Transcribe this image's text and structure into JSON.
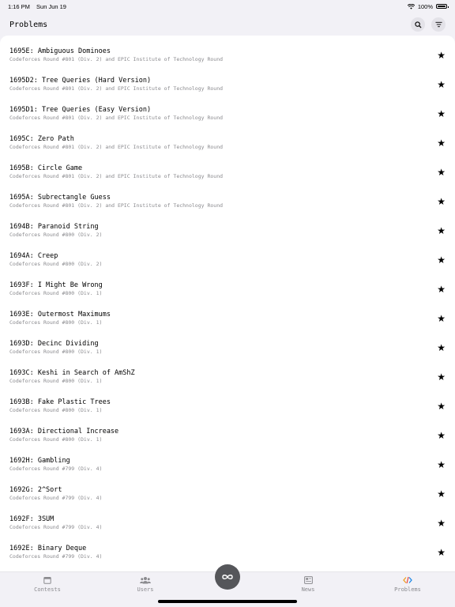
{
  "status": {
    "time": "1:16 PM",
    "date": "Sun Jun 19",
    "battery": "100%"
  },
  "nav": {
    "title": "Problems",
    "search_icon": "search-icon",
    "filter_icon": "filter-icon"
  },
  "problems": [
    {
      "title": "1695E: Ambiguous Dominoes",
      "contest": "Codeforces Round #801 (Div. 2) and EPIC Institute of Technology Round"
    },
    {
      "title": "1695D2: Tree Queries (Hard Version)",
      "contest": "Codeforces Round #801 (Div. 2) and EPIC Institute of Technology Round"
    },
    {
      "title": "1695D1: Tree Queries (Easy Version)",
      "contest": "Codeforces Round #801 (Div. 2) and EPIC Institute of Technology Round"
    },
    {
      "title": "1695C: Zero Path",
      "contest": "Codeforces Round #801 (Div. 2) and EPIC Institute of Technology Round"
    },
    {
      "title": "1695B: Circle Game",
      "contest": "Codeforces Round #801 (Div. 2) and EPIC Institute of Technology Round"
    },
    {
      "title": "1695A: Subrectangle Guess",
      "contest": "Codeforces Round #801 (Div. 2) and EPIC Institute of Technology Round"
    },
    {
      "title": "1694B: Paranoid String",
      "contest": "Codeforces Round #800 (Div. 2)"
    },
    {
      "title": "1694A: Creep",
      "contest": "Codeforces Round #800 (Div. 2)"
    },
    {
      "title": "1693F: I Might Be Wrong",
      "contest": "Codeforces Round #800 (Div. 1)"
    },
    {
      "title": "1693E: Outermost Maximums",
      "contest": "Codeforces Round #800 (Div. 1)"
    },
    {
      "title": "1693D: Decinc Dividing",
      "contest": "Codeforces Round #800 (Div. 1)"
    },
    {
      "title": "1693C: Keshi in Search of AmShZ",
      "contest": "Codeforces Round #800 (Div. 1)"
    },
    {
      "title": "1693B: Fake Plastic Trees",
      "contest": "Codeforces Round #800 (Div. 1)"
    },
    {
      "title": "1693A: Directional Increase",
      "contest": "Codeforces Round #800 (Div. 1)"
    },
    {
      "title": "1692H: Gambling",
      "contest": "Codeforces Round #799 (Div. 4)"
    },
    {
      "title": "1692G: 2^Sort",
      "contest": "Codeforces Round #799 (Div. 4)"
    },
    {
      "title": "1692F: 3SUM",
      "contest": "Codeforces Round #799 (Div. 4)"
    },
    {
      "title": "1692E: Binary Deque",
      "contest": "Codeforces Round #799 (Div. 4)"
    }
  ],
  "star_icon": "star-icon",
  "tabs": [
    {
      "label": "Contests",
      "icon": "calendar-icon"
    },
    {
      "label": "Users",
      "icon": "users-icon"
    },
    {
      "label": "News",
      "icon": "news-icon"
    },
    {
      "label": "Problems",
      "icon": "code-icon"
    }
  ],
  "center_button_icon": "infinity-icon",
  "colors": {
    "accent": "#55565a",
    "list_bg": "#ffffff",
    "page_bg": "#f2f1f6",
    "secondary_text": "#8a8a8e"
  }
}
